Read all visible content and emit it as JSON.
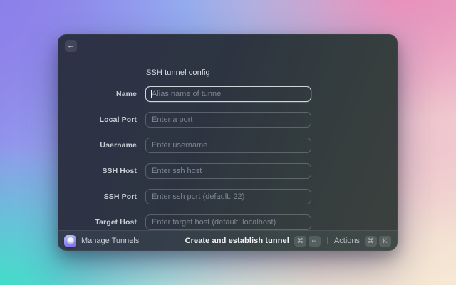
{
  "dialog": {
    "back_icon": "←",
    "title": "SSH tunnel config",
    "fields": [
      {
        "label": "Name",
        "placeholder": "Alias name of tunnel"
      },
      {
        "label": "Local Port",
        "placeholder": "Enter a port"
      },
      {
        "label": "Username",
        "placeholder": "Enter username"
      },
      {
        "label": "SSH Host",
        "placeholder": "Enter ssh host"
      },
      {
        "label": "SSH Port",
        "placeholder": "Enter ssh port (default: 22)"
      },
      {
        "label": "Target Host",
        "placeholder": "Enter target host (default: localhost)"
      }
    ],
    "footer": {
      "app_name": "Manage Tunnels",
      "primary_action_label": "Create and establish tunnel",
      "primary_shortcut_keys": [
        "⌘",
        "↵"
      ],
      "secondary_action_label": "Actions",
      "secondary_shortcut_keys": [
        "⌘",
        "K"
      ]
    }
  },
  "colors": {
    "dialog_bg_start": "#2d3247",
    "dialog_bg_end": "#3c413e",
    "input_border": "rgba(255,255,255,0.22)",
    "focus_border": "#eef3f8",
    "placeholder_text": "#7e8791",
    "wallpaper_purple": "#8c7eea",
    "wallpaper_blue": "#96bff1",
    "wallpaper_pink": "#ec8cb9",
    "wallpaper_teal": "#36e5c3",
    "wallpaper_cream": "#f6e9d4"
  }
}
